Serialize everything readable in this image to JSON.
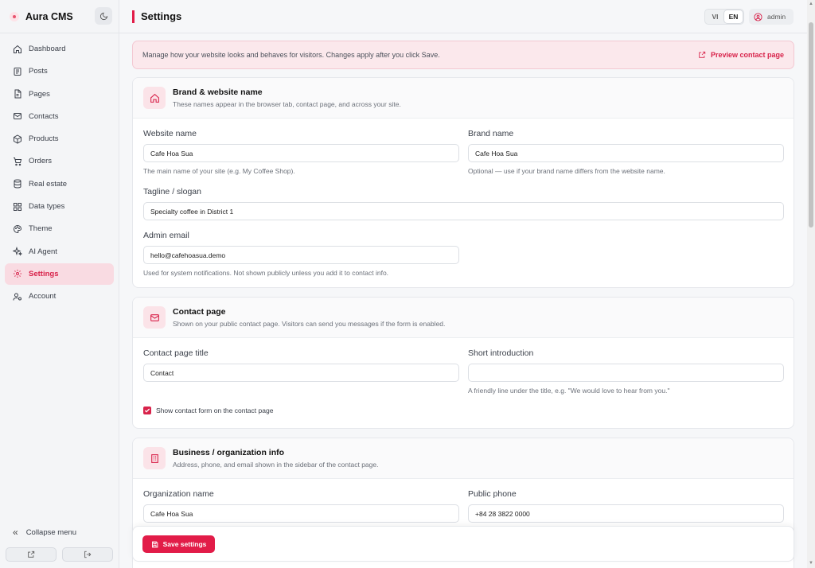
{
  "app": {
    "name": "Aura CMS"
  },
  "sidebar": {
    "items": [
      {
        "label": "Dashboard",
        "icon": "home-icon"
      },
      {
        "label": "Posts",
        "icon": "newspaper-icon"
      },
      {
        "label": "Pages",
        "icon": "file-icon"
      },
      {
        "label": "Contacts",
        "icon": "mail-icon"
      },
      {
        "label": "Products",
        "icon": "box-icon"
      },
      {
        "label": "Orders",
        "icon": "cart-icon"
      },
      {
        "label": "Real estate",
        "icon": "database-icon"
      },
      {
        "label": "Data types",
        "icon": "grid-icon"
      },
      {
        "label": "Theme",
        "icon": "palette-icon"
      },
      {
        "label": "AI Agent",
        "icon": "sparkle-icon"
      },
      {
        "label": "Settings",
        "icon": "gear-icon",
        "active": true
      },
      {
        "label": "Account",
        "icon": "user-cog-icon"
      }
    ],
    "collapse_label": "Collapse menu"
  },
  "header": {
    "title": "Settings",
    "languages": [
      "VI",
      "EN"
    ],
    "active_language": "EN",
    "user": "admin"
  },
  "notice": {
    "text": "Manage how your website looks and behaves for visitors. Changes apply after you click Save.",
    "preview_label": "Preview contact page"
  },
  "brand_section": {
    "title": "Brand & website name",
    "subtitle": "These names appear in the browser tab, contact page, and across your site.",
    "website_name": {
      "label": "Website name",
      "value": "Cafe Hoa Sua",
      "hint": "The main name of your site (e.g. My Coffee Shop)."
    },
    "brand_name": {
      "label": "Brand name",
      "value": "Cafe Hoa Sua",
      "hint": "Optional — use if your brand name differs from the website name."
    },
    "tagline": {
      "label": "Tagline / slogan",
      "value": "Specialty coffee in District 1"
    },
    "admin_email": {
      "label": "Admin email",
      "value": "hello@cafehoasua.demo",
      "hint": "Used for system notifications. Not shown publicly unless you add it to contact info."
    }
  },
  "contact_section": {
    "title": "Contact page",
    "subtitle": "Shown on your public contact page. Visitors can send you messages if the form is enabled.",
    "page_title": {
      "label": "Contact page title",
      "value": "Contact"
    },
    "short_intro": {
      "label": "Short introduction",
      "value": "",
      "hint": "A friendly line under the title, e.g. \"We would love to hear from you.\""
    },
    "show_form": {
      "label": "Show contact form on the contact page",
      "checked": true
    }
  },
  "business_section": {
    "title": "Business / organization info",
    "subtitle": "Address, phone, and email shown in the sidebar of the contact page.",
    "org_name": {
      "label": "Organization name",
      "value": "Cafe Hoa Sua"
    },
    "public_phone": {
      "label": "Public phone",
      "value": "+84 28 3822 0000"
    }
  },
  "footer": {
    "save_label": "Save settings"
  },
  "colors": {
    "accent": "#e21c48",
    "accent_light": "#fbe3e8"
  }
}
